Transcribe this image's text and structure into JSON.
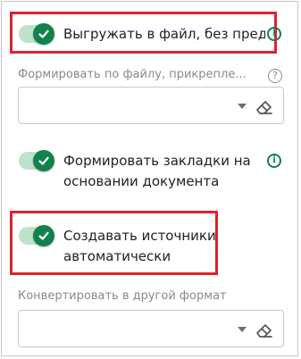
{
  "options": {
    "upload_to_file": {
      "label": "Выгружать в файл, без предварительного просмотра",
      "enabled": true,
      "info_icon": "info-icon"
    },
    "bookmarks": {
      "label_line1": "Формировать закладки на",
      "label_line2": "основании документа",
      "enabled": true,
      "info_icon": "info-icon"
    },
    "auto_sources": {
      "label_line1": "Создавать источники",
      "label_line2": "автоматически",
      "enabled": true
    }
  },
  "fields": {
    "attached_file": {
      "label": "Формировать по файлу, прикрепле...",
      "help_symbol": "?",
      "value": ""
    },
    "convert_format": {
      "label": "Конвертировать в другой формат",
      "value": ""
    }
  },
  "colors": {
    "accent": "#12824c",
    "track": "#bfe2cd",
    "highlight": "#e2202b"
  }
}
